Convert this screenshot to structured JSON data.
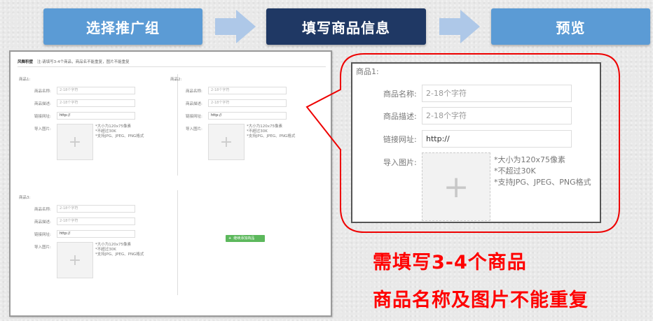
{
  "steps": {
    "step1": "选择推广组",
    "step2": "填写商品信息",
    "step3": "预览"
  },
  "colors": {
    "step_inactive": "#5b9bd5",
    "step_active": "#1f3864",
    "arrow": "#aec8e8",
    "highlight": "#ff0000"
  },
  "mini": {
    "header_title": "风舞积壁",
    "header_hint": "注:请填写3-4个商品，商品名不能重复，图片不能重复",
    "groups": [
      {
        "title": "商品1:",
        "name_label": "商品名称:",
        "name_placeholder": "2-18个字符",
        "desc_label": "商品描述:",
        "desc_placeholder": "2-18个字符",
        "link_label": "链接网址:",
        "link_value": "http://",
        "image_label": "导入图片:"
      },
      {
        "title": "商品2:",
        "name_label": "商品名称:",
        "name_placeholder": "2-18个字符",
        "desc_label": "商品描述:",
        "desc_placeholder": "2-18个字符",
        "link_label": "链接网址:",
        "link_value": "http://",
        "image_label": "导入图片:"
      },
      {
        "title": "商品3:",
        "name_label": "商品名称:",
        "name_placeholder": "2-18个字符",
        "desc_label": "商品描述:",
        "desc_placeholder": "2-18个字符",
        "link_label": "链接网址:",
        "link_value": "http://",
        "image_label": "导入图片:"
      }
    ],
    "image_notes": [
      "*大小为120x75像素",
      "*不超过30K",
      "*支持JPG、JPEG、PNG格式"
    ],
    "add_button": "继续添加商品"
  },
  "zoom": {
    "title": "商品1:",
    "name_label": "商品名称:",
    "name_placeholder": "2-18个字符",
    "desc_label": "商品描述:",
    "desc_placeholder": "2-18个字符",
    "link_label": "链接网址:",
    "link_value": "http://",
    "image_label": "导入图片:",
    "image_notes": [
      "*大小为120x75像素",
      "*不超过30K",
      "*支持JPG、JPEG、PNG格式"
    ]
  },
  "notes": {
    "line1": "需填写3-4个商品",
    "line2": "商品名称及图片不能重复"
  }
}
